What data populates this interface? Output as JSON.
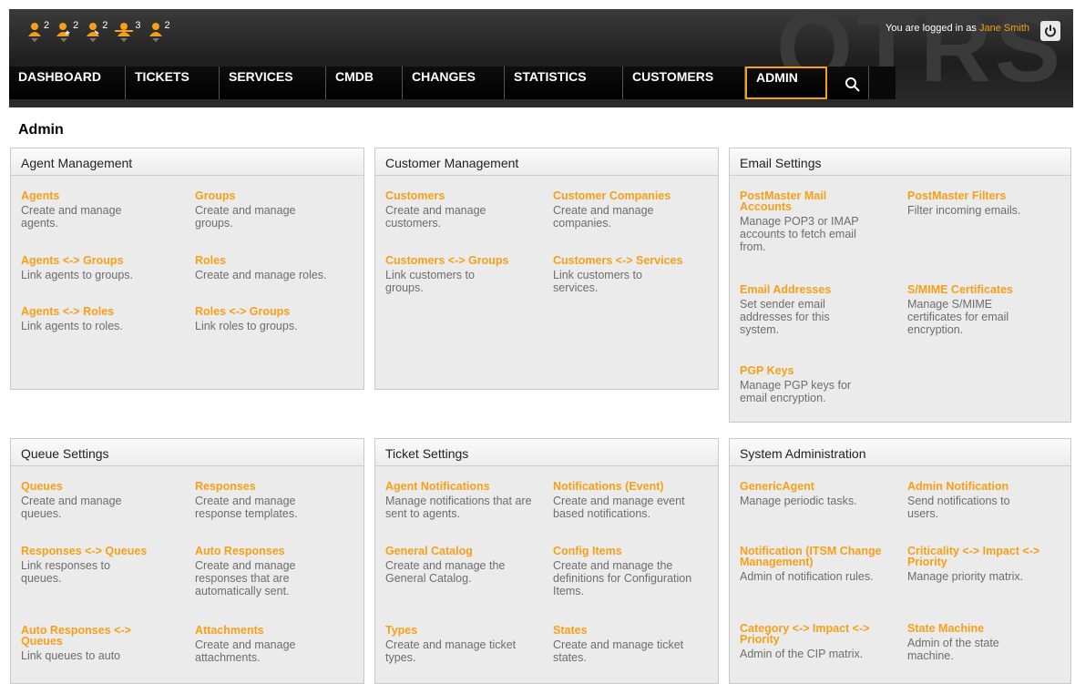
{
  "header": {
    "logo_text": "OTRS",
    "user_prefix": "You are logged in as",
    "user_name": "Jane Smith",
    "toolbar": [
      {
        "icon": "agent-icon",
        "count": "2"
      },
      {
        "icon": "agent-star-icon",
        "count": "2"
      },
      {
        "icon": "agent-run-icon",
        "count": "2"
      },
      {
        "icon": "agent-lock-icon",
        "count": "3"
      },
      {
        "icon": "agent-icon",
        "count": "2"
      }
    ]
  },
  "nav": {
    "items": [
      "DASHBOARD",
      "TICKETS",
      "SERVICES",
      "CMDB",
      "CHANGES",
      "STATISTICS",
      "CUSTOMERS",
      "ADMIN"
    ],
    "active": "ADMIN",
    "search_icon": "search-icon"
  },
  "page": {
    "title": "Admin",
    "boxes": [
      {
        "title": "Agent Management",
        "items": [
          {
            "title": "Agents",
            "desc": "Create and manage agents."
          },
          {
            "title": "Groups",
            "desc": "Create and manage groups."
          },
          {
            "title": "Agents <-> Groups",
            "desc": "Link agents to groups."
          },
          {
            "title": "Roles",
            "desc": "Create and manage roles."
          },
          {
            "title": "Agents <-> Roles",
            "desc": "Link agents to roles."
          },
          {
            "title": "Roles <-> Groups",
            "desc": "Link roles to groups."
          }
        ]
      },
      {
        "title": "Customer Management",
        "items": [
          {
            "title": "Customers",
            "desc": "Create and manage customers."
          },
          {
            "title": "Customer Companies",
            "desc": "Create and manage companies."
          },
          {
            "title": "Customers <-> Groups",
            "desc": "Link customers to groups."
          },
          {
            "title": "Customers <-> Services",
            "desc": "Link customers to services."
          }
        ]
      },
      {
        "title": "Email Settings",
        "items": [
          {
            "title": "PostMaster Mail Accounts",
            "desc": "Manage POP3 or IMAP accounts to fetch email from."
          },
          {
            "title": "PostMaster Filters",
            "desc": "Filter incoming emails."
          },
          {
            "title": "Email Addresses",
            "desc": "Set sender email addresses for this system."
          },
          {
            "title": "S/MIME Certificates",
            "desc": "Manage S/MIME certificates for email encryption."
          },
          {
            "title": "PGP Keys",
            "desc": "Manage PGP keys for email encryption."
          }
        ]
      },
      {
        "title": "Queue Settings",
        "items": [
          {
            "title": "Queues",
            "desc": "Create and manage queues."
          },
          {
            "title": "Responses",
            "desc": "Create and manage response templates."
          },
          {
            "title": "Responses <-> Queues",
            "desc": "Link responses to queues."
          },
          {
            "title": "Auto Responses",
            "desc": "Create and manage responses that are automatically sent."
          },
          {
            "title": "Auto Responses <-> Queues",
            "desc": "Link queues to auto"
          },
          {
            "title": "Attachments",
            "desc": "Create and manage attachments."
          }
        ]
      },
      {
        "title": "Ticket Settings",
        "items": [
          {
            "title": "Agent Notifications",
            "desc": "Manage notifications that are sent to agents."
          },
          {
            "title": "Notifications (Event)",
            "desc": "Create and manage event based notifications."
          },
          {
            "title": "General Catalog",
            "desc": "Create and manage the General Catalog."
          },
          {
            "title": "Config Items",
            "desc": "Create and manage the definitions for Configuration Items."
          },
          {
            "title": "Types",
            "desc": "Create and manage ticket types."
          },
          {
            "title": "States",
            "desc": "Create and manage ticket states."
          }
        ]
      },
      {
        "title": "System Administration",
        "items": [
          {
            "title": "GenericAgent",
            "desc": "Manage periodic tasks."
          },
          {
            "title": "Admin Notification",
            "desc": "Send notifications to users."
          },
          {
            "title": "Notification (ITSM Change Management)",
            "desc": "Admin of notification rules."
          },
          {
            "title": "Criticality <-> Impact <-> Priority",
            "desc": "Manage priority matrix."
          },
          {
            "title": "Category <-> Impact <-> Priority",
            "desc": "Admin of the CIP matrix."
          },
          {
            "title": "State Machine",
            "desc": "Admin of the state machine."
          }
        ]
      }
    ]
  },
  "colors": {
    "accent": "#f6a019",
    "header_bg": "#1e1e1e",
    "box_bg": "#ebebeb"
  }
}
